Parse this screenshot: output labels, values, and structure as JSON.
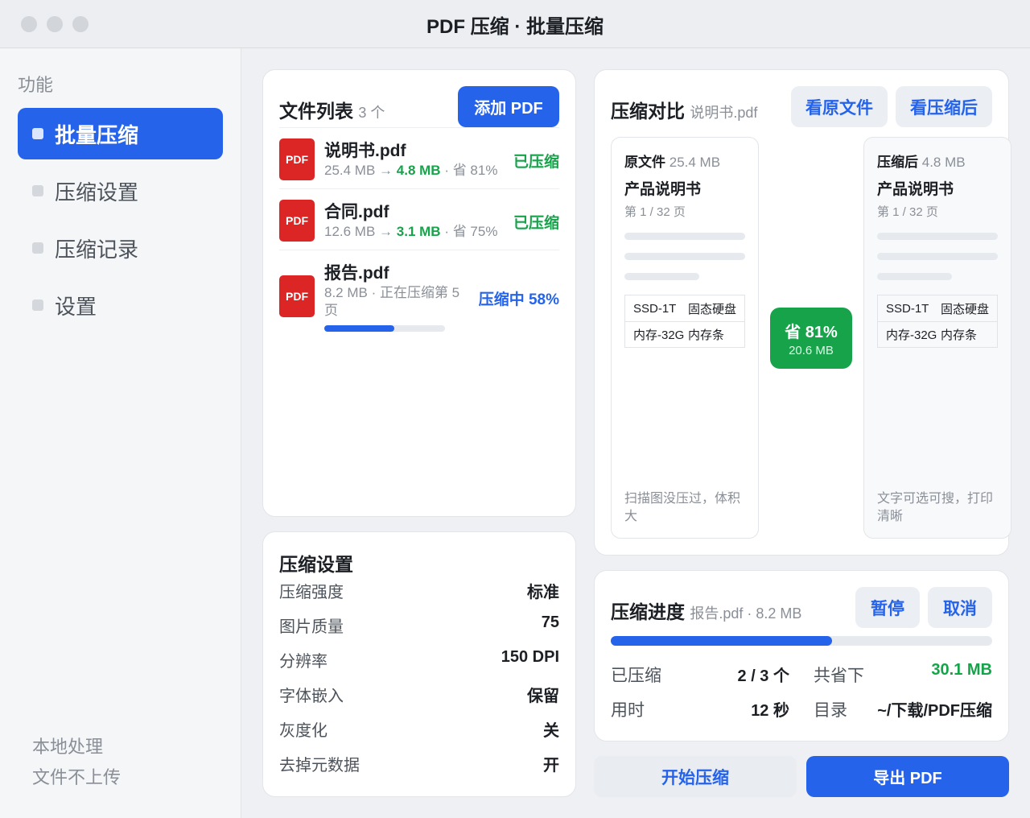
{
  "window": {
    "title": "PDF 压缩 · 批量压缩"
  },
  "sidebar": {
    "heading": "功能",
    "items": [
      {
        "label": "批量压缩",
        "active": true
      },
      {
        "label": "压缩设置",
        "active": false
      },
      {
        "label": "压缩记录",
        "active": false
      },
      {
        "label": "设置",
        "active": false
      }
    ],
    "footer": [
      "本地处理",
      "文件不上传"
    ]
  },
  "file_list": {
    "title": "文件列表",
    "count": "3 个",
    "add_button": "添加 PDF",
    "files": [
      {
        "icon": "PDF",
        "name": "说明书.pdf",
        "orig_size": "25.4 MB",
        "arrow": "→",
        "new_size": "4.8 MB",
        "saving": "· 省 81%",
        "status": "已压缩"
      },
      {
        "icon": "PDF",
        "name": "合同.pdf",
        "orig_size": "12.6 MB",
        "arrow": "→",
        "new_size": "3.1 MB",
        "saving": "· 省 75%",
        "status": "已压缩"
      },
      {
        "icon": "PDF",
        "name": "报告.pdf",
        "meta": "8.2 MB · 正在压缩第 5 页",
        "status": "压缩中 58%",
        "progress": 0.58
      }
    ]
  },
  "settings": {
    "title": "压缩设置",
    "rows": [
      {
        "label": "压缩强度",
        "value": "标准"
      },
      {
        "label": "图片质量",
        "value": "75"
      },
      {
        "label": "分辨率",
        "value": "150 DPI"
      },
      {
        "label": "字体嵌入",
        "value": "保留"
      },
      {
        "label": "灰度化",
        "value": "关"
      },
      {
        "label": "去掉元数据",
        "value": "开"
      }
    ]
  },
  "compare": {
    "title": "压缩对比",
    "file": "说明书.pdf",
    "btn_original": "看原文件",
    "btn_compressed": "看压缩后",
    "original": {
      "label": "原文件",
      "size": "25.4 MB",
      "doc_title": "产品说明书",
      "page": "第 1 / 32 页",
      "table": [
        [
          "SSD-1T",
          "固态硬盘"
        ],
        [
          "内存-32G",
          "内存条"
        ]
      ],
      "note": "扫描图没压过，体积大"
    },
    "compressed": {
      "label": "压缩后",
      "size": "4.8 MB",
      "doc_title": "产品说明书",
      "page": "第 1 / 32 页",
      "table": [
        [
          "SSD-1T",
          "固态硬盘"
        ],
        [
          "内存-32G",
          "内存条"
        ]
      ],
      "note": "文字可选可搜，打印清晰"
    },
    "saving": {
      "percent": "省 81%",
      "amount": "20.6 MB"
    }
  },
  "progress": {
    "title": "压缩进度",
    "file": "报告.pdf · 8.2 MB",
    "pause": "暂停",
    "cancel": "取消",
    "fraction": 0.58,
    "stats": {
      "done_label": "已压缩",
      "done_value": "2 / 3 个",
      "saved_label": "共省下",
      "saved_value": "30.1 MB",
      "time_label": "用时",
      "time_value": "12 秒",
      "dir_label": "目录",
      "dir_value": "~/下载/PDF压缩"
    }
  },
  "actions": {
    "start": "开始压缩",
    "export": "导出 PDF"
  },
  "colors": {
    "accent": "#2563eb",
    "success": "#16a34a",
    "pdf": "#dc2626"
  }
}
